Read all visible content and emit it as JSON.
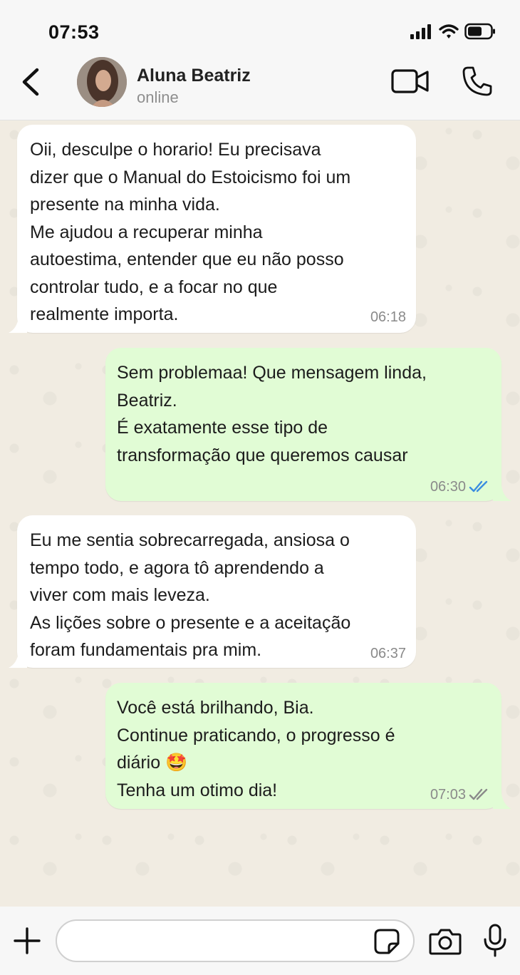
{
  "status_bar": {
    "time": "07:53"
  },
  "header": {
    "contact_name": "Aluna Beatriz",
    "contact_status": "online",
    "icons": [
      "back-chevron-icon",
      "avatar",
      "video-camera-icon",
      "phone-icon"
    ]
  },
  "messages": [
    {
      "direction": "in",
      "text": "Oii, desculpe o horario! Eu precisava\ndizer que o Manual do Estoicismo foi um\npresente na minha vida.\nMe ajudou a recuperar minha\nautoestima, entender que eu não posso\ncontrolar tudo, e a focar no que\nrealmente importa.",
      "time": "06:18"
    },
    {
      "direction": "out",
      "text": "Sem problemaa! Que mensagem linda,\nBeatriz.\nÉ exatamente esse tipo de\ntransformação que queremos causar",
      "time": "06:30",
      "read_status": "read",
      "tick_color": "#3b8de0"
    },
    {
      "direction": "in",
      "text": "Eu me sentia sobrecarregada, ansiosa o\ntempo todo, e agora tô aprendendo a\nviver com mais leveza.\nAs lições sobre o presente e a aceitação\nforam fundamentais pra mim.",
      "time": "06:37"
    },
    {
      "direction": "out",
      "text": "Você está brilhando, Bia.\nContinue praticando, o progresso é\ndiário 🤩\nTenha um otimo dia!",
      "time": "07:03",
      "read_status": "delivered",
      "tick_color": "#8a8a8a"
    }
  ],
  "input_bar": {
    "placeholder": "",
    "icons": [
      "plus-icon",
      "sticker-icon",
      "camera-icon",
      "microphone-icon"
    ]
  },
  "colors": {
    "incoming_bubble": "#ffffff",
    "outgoing_bubble": "#e1fcd5",
    "chat_background": "#f1ece2",
    "read_ticks": "#3b8de0"
  }
}
